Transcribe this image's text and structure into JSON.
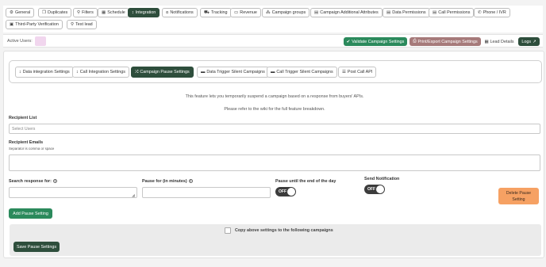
{
  "top_tabs": [
    {
      "label": "General",
      "icon": "gear-icon",
      "glyph": "⚙",
      "active": false
    },
    {
      "label": "Duplicates",
      "icon": "copy-icon",
      "glyph": "❐",
      "active": false
    },
    {
      "label": "Filters",
      "icon": "filter-icon",
      "glyph": "⚲",
      "active": false
    },
    {
      "label": "Schedule",
      "icon": "calendar-icon",
      "glyph": "▦",
      "active": false
    },
    {
      "label": "Integration",
      "icon": "arrows-vertical-icon",
      "glyph": "↕",
      "active": true
    },
    {
      "label": "Notifications",
      "icon": "bell-icon",
      "glyph": "⍝",
      "active": false
    },
    {
      "label": "Tracking",
      "icon": "truck-icon",
      "glyph": "⛟",
      "active": false
    },
    {
      "label": "Revenue",
      "icon": "money-icon",
      "glyph": "▭",
      "active": false
    },
    {
      "label": "Campaign groups",
      "icon": "sitemap-icon",
      "glyph": "⁂",
      "active": false
    },
    {
      "label": "Campaign Additional Attributes",
      "icon": "document-icon",
      "glyph": "▤",
      "active": false
    },
    {
      "label": "Data Permissions",
      "icon": "data-file-icon",
      "glyph": "▤",
      "active": false
    },
    {
      "label": "Call Permissions",
      "icon": "call-file-icon",
      "glyph": "▤",
      "active": false
    },
    {
      "label": "Phone / IVR",
      "icon": "phone-icon",
      "glyph": "✆",
      "active": false
    },
    {
      "label": "Third-Party Verification",
      "icon": "id-card-icon",
      "glyph": "▣",
      "active": false
    },
    {
      "label": "Test lead",
      "icon": "pin-icon",
      "glyph": "⚲",
      "active": false
    }
  ],
  "topbar": {
    "active_users_label": "Active Users:",
    "validate_label": "Validate Campaign Settings",
    "print_label": "Print/Export Campaign Settings",
    "lead_details_label": "Lead Details",
    "logs_label": "Logs"
  },
  "sub_tabs": [
    {
      "label": "Data integration Settings",
      "icon": "arrows-vertical-icon",
      "glyph": "↕",
      "active": false
    },
    {
      "label": "Call Integration Settings",
      "icon": "arrows-vertical-icon",
      "glyph": "↕",
      "active": false
    },
    {
      "label": "Campaign Pause Settings",
      "icon": "shuffle-icon",
      "glyph": "⤮",
      "active": true
    },
    {
      "label": "Data Trigger Silent Campaigns",
      "icon": "monitor-icon",
      "glyph": "▬",
      "active": false
    },
    {
      "label": "Call Trigger Silent Campaigns",
      "icon": "monitor-icon",
      "glyph": "▬",
      "active": false
    },
    {
      "label": "Post Call API",
      "icon": "list-icon",
      "glyph": "☰",
      "active": false
    }
  ],
  "info": {
    "line1": "This feature lets you temporarily suspend a campaign based on a response from buyers' APIs.",
    "line2": "Please refer to the wiki for the full feature breakdown."
  },
  "recipient_list": {
    "label": "Recipient List",
    "placeholder": "Select Users"
  },
  "recipient_emails": {
    "label": "Recipient Emails",
    "hint": "Separator is comma or space",
    "value": ""
  },
  "search_response": {
    "label": "Search response for:",
    "value": ""
  },
  "pause_for": {
    "label": "Pause for (in minutes)",
    "value": ""
  },
  "pause_until": {
    "label": "Pause until the end of the day",
    "toggle": "OFF"
  },
  "send_notification": {
    "label": "Send Notification",
    "toggle": "OFF"
  },
  "delete_button": "Delete Pause Setting",
  "add_button": "Add Pause Setting",
  "copy_label": "Copy above settings to the following campaigns",
  "save_button": "Save Pause Settings",
  "colors": {
    "accent": "#2e4e3c",
    "validate": "#2b8a5c",
    "print": "#a67a7a",
    "delete": "#f6a163"
  }
}
